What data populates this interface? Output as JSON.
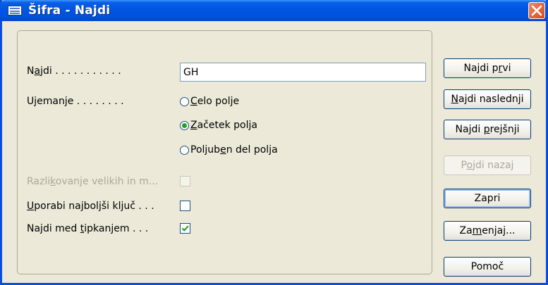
{
  "window": {
    "title": "Šifra - Najdi"
  },
  "find": {
    "label_pre": "N",
    "label_u": "a",
    "label_post": "jdi",
    "dots": " . . . . . . . . . . .",
    "value": "GH"
  },
  "match": {
    "label": "Ujemanje",
    "dots": " . . . . . . . .",
    "options": [
      {
        "pre": "",
        "u": "C",
        "post": "elo polje",
        "checked": false
      },
      {
        "pre": "",
        "u": "Z",
        "post": "ačetek polja",
        "checked": true
      },
      {
        "pre": "Poljub",
        "u": "e",
        "post": "n del polja",
        "checked": false
      }
    ]
  },
  "case_sensitive": {
    "pre": "Razli",
    "u": "k",
    "post": "ovanje velikih in m...",
    "checked": false,
    "enabled": false
  },
  "best_key": {
    "pre": "",
    "u": "U",
    "post": "porabi najboljši ključ",
    "dots": " . . .",
    "checked": false
  },
  "find_as_type": {
    "pre": "Najdi med ",
    "u": "t",
    "post": "ipkanjem",
    "dots": " . . .",
    "checked": true
  },
  "buttons": {
    "find_first": {
      "pre": "Najdi p",
      "u": "r",
      "post": "vi"
    },
    "find_next": {
      "pre": "",
      "u": "N",
      "post": "ajdi naslednji"
    },
    "find_previous": {
      "pre": "Najdi ",
      "u": "p",
      "post": "rejšnji"
    },
    "go_back": {
      "pre": "P",
      "u": "o",
      "post": "jdi nazaj"
    },
    "close": {
      "pre": "Zapri",
      "u": "",
      "post": ""
    },
    "replace": {
      "pre": "Za",
      "u": "m",
      "post": "enjaj..."
    },
    "help": {
      "pre": "Pomoč",
      "u": "",
      "post": ""
    }
  },
  "colors": {
    "titlebar": "#0054e3",
    "face": "#ece9d8",
    "check": "#21a121",
    "close": "#e0521f"
  },
  "icons": {
    "title": "table-icon",
    "close": "close-icon"
  }
}
